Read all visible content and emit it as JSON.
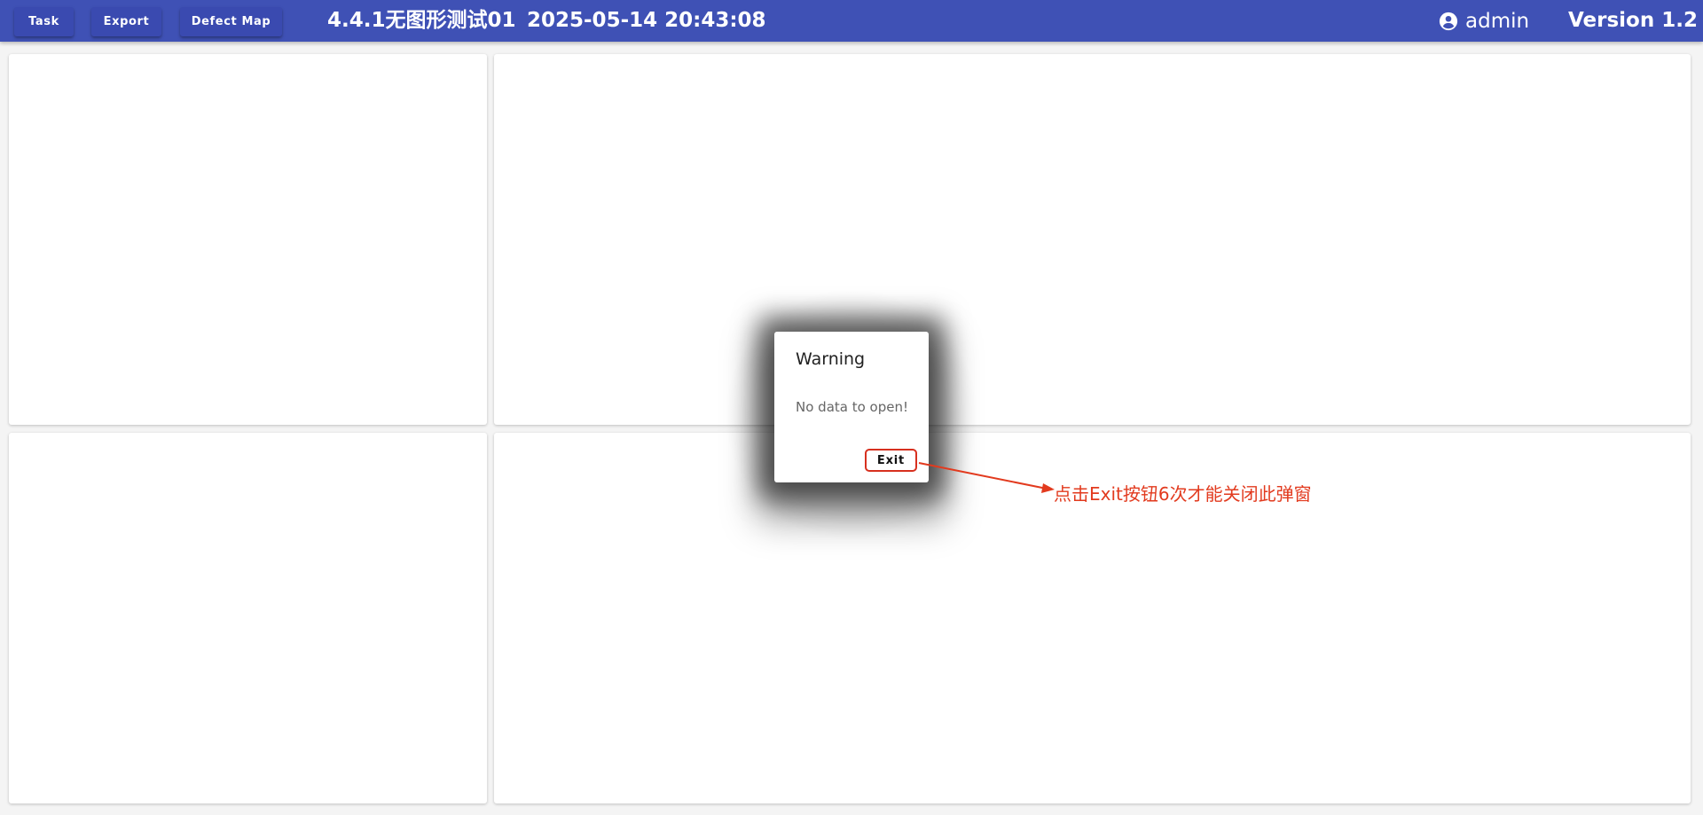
{
  "toolbar": {
    "task_label": "Task",
    "export_label": "Export",
    "defect_map_label": "Defect Map"
  },
  "header": {
    "project_title": "4.4.1无图形测试01",
    "datetime": "2025-05-14 20:43:08",
    "user_name": "admin",
    "version": "Version 1.2",
    "user_icon": "account-circle-icon"
  },
  "dialog": {
    "title": "Warning",
    "message": "No data to open!",
    "exit_label": "Exit"
  },
  "annotation": {
    "text": "点击Exit按钮6次才能关闭此弹窗",
    "color": "#e23a1e"
  },
  "colors": {
    "header_bg": "#3f51b5",
    "page_bg": "#f4f4f4",
    "panel_bg": "#ffffff",
    "highlight": "#d7301f"
  }
}
